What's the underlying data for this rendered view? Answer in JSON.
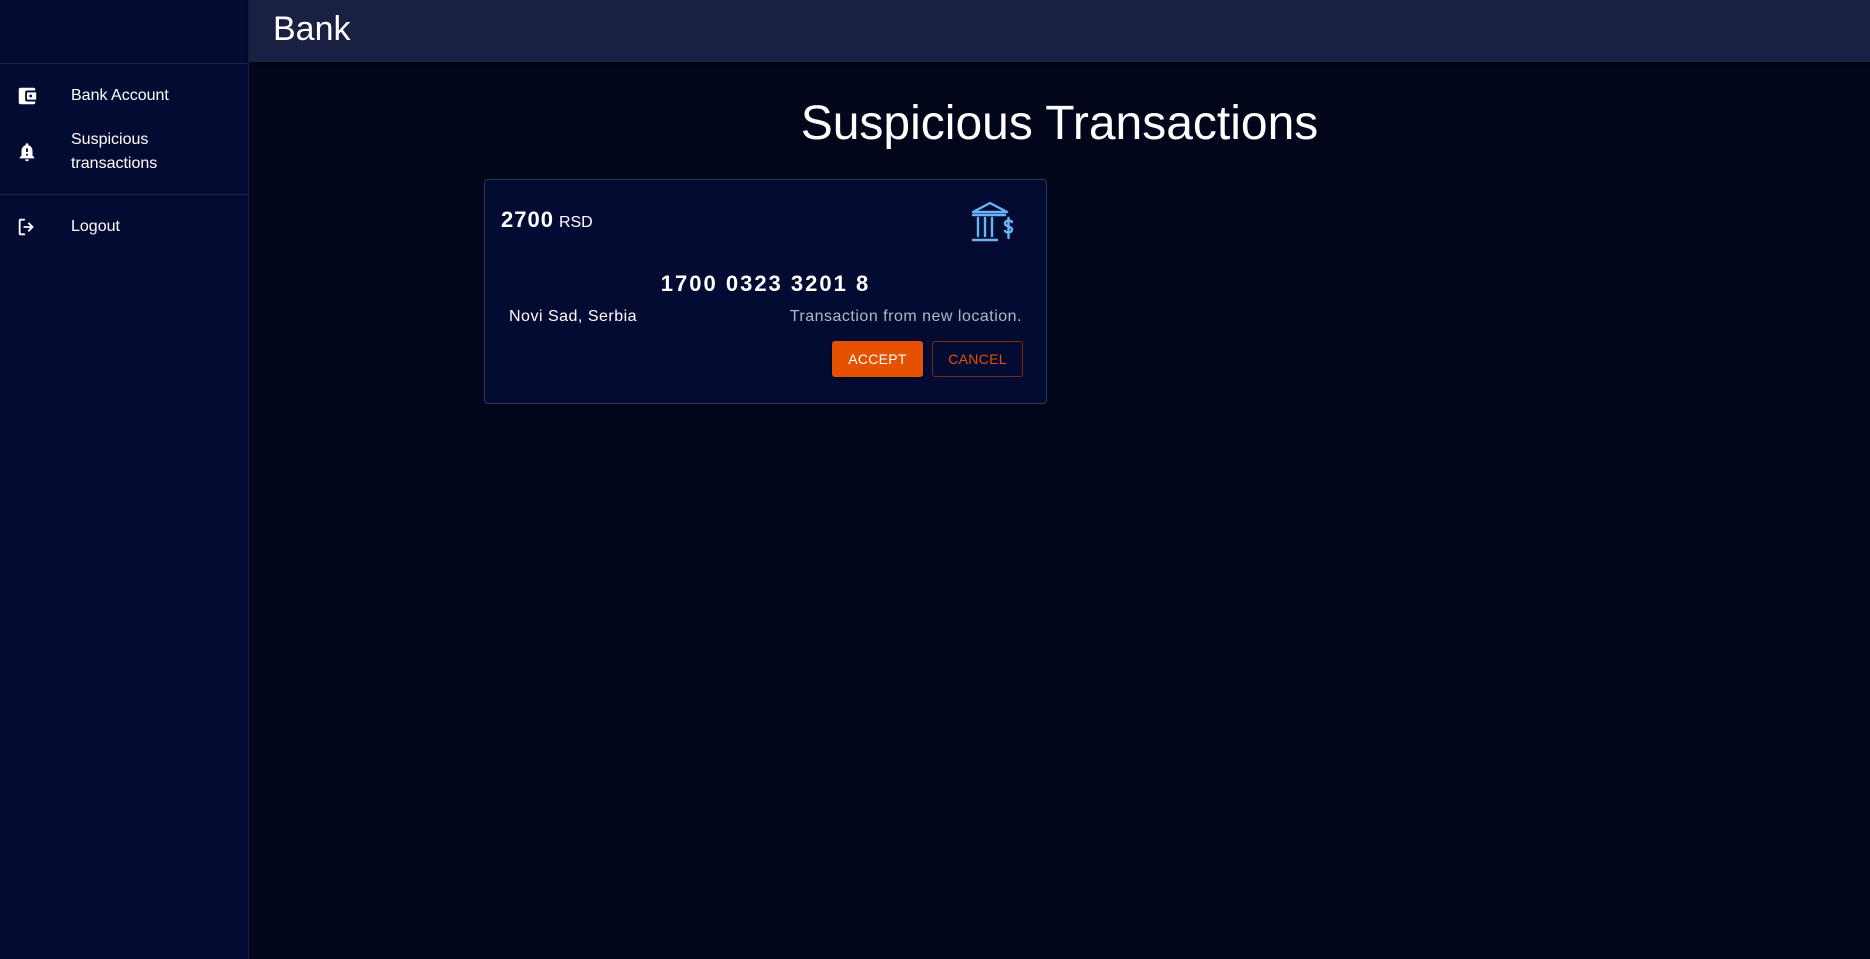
{
  "app": {
    "title": "Bank"
  },
  "sidebar": {
    "items": [
      {
        "label": "Bank Account",
        "icon": "wallet-icon"
      },
      {
        "label": "Suspicious transactions",
        "icon": "bell-alert-icon"
      },
      {
        "label": "Logout",
        "icon": "logout-icon"
      }
    ]
  },
  "main": {
    "title": "Suspicious Transactions",
    "transactions": [
      {
        "amount": "2700",
        "currency": "RSD",
        "account_number": "1700 0323 3201 8",
        "location": "Novi Sad, Serbia",
        "reason": "Transaction from new location.",
        "icon": "bank-dollar-icon",
        "accept_label": "ACCEPT",
        "cancel_label": "CANCEL"
      }
    ]
  },
  "colors": {
    "background": "#02061a",
    "sidebar": "#040b33",
    "header": "#1a2042",
    "accent": "#e65100",
    "icon_blue": "#6ab4f5"
  }
}
